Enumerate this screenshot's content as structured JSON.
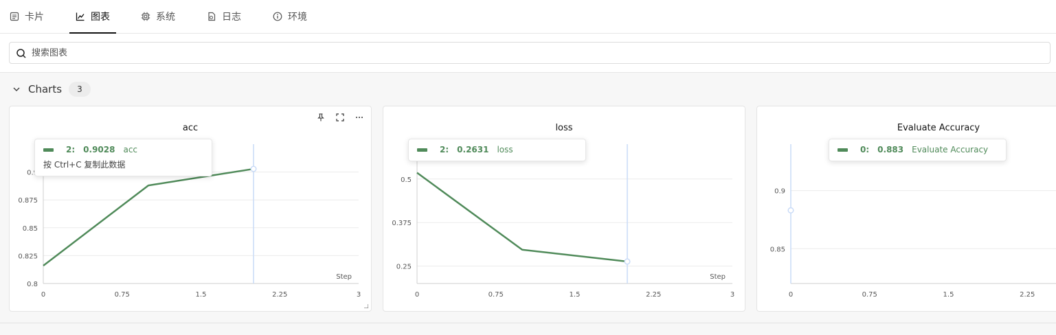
{
  "tabs": [
    {
      "label": "卡片",
      "icon": "card-icon"
    },
    {
      "label": "图表",
      "icon": "line-chart-icon",
      "active": true
    },
    {
      "label": "系统",
      "icon": "cpu-icon"
    },
    {
      "label": "日志",
      "icon": "log-file-icon"
    },
    {
      "label": "环境",
      "icon": "info-icon"
    }
  ],
  "search": {
    "placeholder": "搜索图表",
    "value": ""
  },
  "section": {
    "title": "Charts",
    "count": "3"
  },
  "colors": {
    "series": "#4f8a59",
    "crosshair": "#c9dbf7",
    "grid": "#ececec"
  },
  "cards": [
    {
      "title": "acc",
      "tooltip": {
        "step": "2:",
        "value": "0.9028",
        "name": "acc",
        "hint": "按 Ctrl+C 复制此数据"
      }
    },
    {
      "title": "loss",
      "tooltip": {
        "step": "2:",
        "value": "0.2631",
        "name": "loss"
      }
    },
    {
      "title": "Evaluate Accuracy",
      "tooltip": {
        "step": "0:",
        "value": "0.883",
        "name": "Evaluate Accuracy"
      }
    }
  ],
  "chart_data": [
    {
      "type": "line",
      "title": "acc",
      "xlabel": "Step",
      "ylabel": "",
      "xlim": [
        0,
        3
      ],
      "ylim": [
        0.8,
        0.925
      ],
      "xticks": [
        "0",
        "0.75",
        "1.5",
        "2.25",
        "3"
      ],
      "yticks": [
        {
          "v": 0.8,
          "label": "0.8"
        },
        {
          "v": 0.825,
          "label": "0.825"
        },
        {
          "v": 0.85,
          "label": "0.85"
        },
        {
          "v": 0.875,
          "label": "0.875"
        },
        {
          "v": 0.9,
          "label": "0.9"
        }
      ],
      "series": [
        {
          "name": "acc",
          "x": [
            0,
            1,
            2
          ],
          "y": [
            0.816,
            0.888,
            0.9028
          ]
        }
      ],
      "hover_x": 2
    },
    {
      "type": "line",
      "title": "loss",
      "xlabel": "Step",
      "ylabel": "",
      "xlim": [
        0,
        3
      ],
      "ylim": [
        0.2,
        0.6
      ],
      "xticks": [
        "0",
        "0.75",
        "1.5",
        "2.25",
        "3"
      ],
      "yticks": [
        {
          "v": 0.25,
          "label": "0.25"
        },
        {
          "v": 0.375,
          "label": "0.375"
        },
        {
          "v": 0.5,
          "label": "0.5"
        }
      ],
      "series": [
        {
          "name": "loss",
          "x": [
            0,
            1,
            2
          ],
          "y": [
            0.518,
            0.297,
            0.2631
          ]
        }
      ],
      "hover_x": 2
    },
    {
      "type": "line",
      "title": "Evaluate Accuracy",
      "xlabel": "",
      "ylabel": "",
      "xlim": [
        0,
        3
      ],
      "ylim": [
        0.82,
        0.94
      ],
      "xticks": [
        "0",
        "0.75",
        "1.5",
        "2.25"
      ],
      "yticks": [
        {
          "v": 0.85,
          "label": "0.85"
        },
        {
          "v": 0.9,
          "label": "0.9"
        }
      ],
      "series": [
        {
          "name": "Evaluate Accuracy",
          "x": [
            0
          ],
          "y": [
            0.883
          ]
        }
      ],
      "hover_x": 0
    }
  ]
}
